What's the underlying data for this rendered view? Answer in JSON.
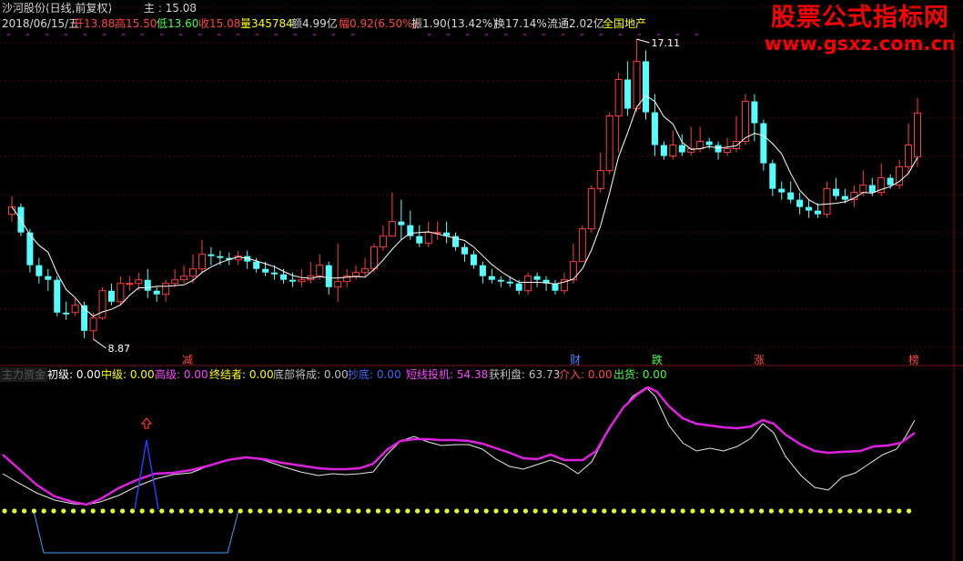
{
  "header": {
    "title": "沙河股份(日线,前复权)",
    "date": "2018/06/15/五",
    "main_label": "主 : 15.08",
    "open": "开13.88",
    "high": "高15.50",
    "low": "低13.60",
    "close": "收15.08",
    "volume": "量345784",
    "amount": "额4.99亿",
    "change": "幅0.92(6.50%)",
    "amplitude": "振1.90(13.42%)",
    "turnover": "换17.14%",
    "float_shares": "流通2.02亿",
    "sector": "全国地产"
  },
  "watermark": {
    "line1": "股票公式指标网",
    "line2": "www.gsxz.com.cn"
  },
  "chart_labels": {
    "high_mark": "17.11",
    "low_mark": "8.87"
  },
  "event_tags": [
    {
      "text": "减",
      "color": "#ff4444"
    },
    {
      "text": "财",
      "color": "#4488ff"
    },
    {
      "text": "跌",
      "color": "#44ff44"
    },
    {
      "text": "涨",
      "color": "#ff4444"
    },
    {
      "text": "榜",
      "color": "#ff4444"
    }
  ],
  "indicator": {
    "tab": "主力资金",
    "items": [
      {
        "label": "初级: 0.00",
        "color": "#ffffff"
      },
      {
        "label": "中级: 0.00",
        "color": "#ffff00"
      },
      {
        "label": "高级: 0.00",
        "color": "#ff44ff"
      },
      {
        "label": "终结者: 0.00",
        "color": "#ffff00"
      },
      {
        "label": "底部将成: 0.00",
        "color": "#c0c0c0"
      },
      {
        "label": "抄底: 0.00",
        "color": "#4466ff"
      },
      {
        "label": "短线投机: 54.38",
        "color": "#ff44ff"
      },
      {
        "label": "获利盘: 63.73",
        "color": "#c0c0c0"
      },
      {
        "label": "介入: 0.00",
        "color": "#ff4444"
      },
      {
        "label": "出货: 0.00",
        "color": "#44ff44"
      }
    ]
  },
  "colors": {
    "up": "#ff3c3c",
    "down": "#54ffff",
    "ma": "#ffffff",
    "bg": "#000000",
    "grid": "#3a0000"
  },
  "chart_data": {
    "type": "candlestick",
    "price_high": 17.11,
    "price_low": 8.87,
    "candles": [
      [
        12.3,
        12.5,
        12.8,
        12.1
      ],
      [
        12.5,
        11.8,
        12.6,
        11.7
      ],
      [
        11.8,
        10.9,
        11.9,
        10.7
      ],
      [
        10.9,
        10.6,
        11.1,
        10.4
      ],
      [
        10.6,
        10.5,
        10.8,
        10.2
      ],
      [
        10.5,
        9.6,
        10.6,
        9.5
      ],
      [
        9.6,
        9.55,
        9.9,
        9.4
      ],
      [
        9.6,
        9.8,
        10.0,
        9.5
      ],
      [
        9.8,
        9.1,
        9.9,
        8.9
      ],
      [
        9.1,
        9.45,
        9.6,
        8.87
      ],
      [
        9.45,
        10.2,
        10.3,
        9.4
      ],
      [
        10.2,
        9.9,
        10.4,
        9.8
      ],
      [
        9.9,
        10.4,
        10.6,
        9.8
      ],
      [
        10.4,
        10.4,
        10.6,
        10.2
      ],
      [
        10.4,
        10.5,
        10.7,
        10.2
      ],
      [
        10.5,
        10.2,
        10.8,
        10.0
      ],
      [
        10.2,
        10.1,
        10.3,
        9.9
      ],
      [
        10.1,
        10.4,
        10.5,
        9.9
      ],
      [
        10.4,
        10.5,
        10.8,
        10.3
      ],
      [
        10.5,
        10.6,
        10.9,
        10.4
      ],
      [
        10.6,
        10.8,
        11.2,
        10.4
      ],
      [
        10.8,
        11.2,
        11.6,
        10.7
      ],
      [
        11.2,
        11.15,
        11.4,
        10.9
      ],
      [
        11.15,
        11.1,
        11.3,
        10.9
      ],
      [
        11.1,
        11.05,
        11.25,
        10.9
      ],
      [
        11.05,
        11.15,
        11.3,
        10.9
      ],
      [
        11.15,
        11.0,
        11.3,
        10.8
      ],
      [
        11.0,
        10.8,
        11.1,
        10.7
      ],
      [
        10.8,
        10.7,
        11.0,
        10.6
      ],
      [
        10.7,
        10.65,
        10.9,
        10.5
      ],
      [
        10.65,
        10.5,
        10.8,
        10.4
      ],
      [
        10.5,
        10.45,
        10.7,
        10.3
      ],
      [
        10.45,
        10.5,
        10.8,
        10.3
      ],
      [
        10.5,
        10.6,
        11.0,
        10.4
      ],
      [
        10.6,
        10.9,
        11.2,
        10.5
      ],
      [
        10.9,
        10.3,
        11.0,
        10.1
      ],
      [
        10.3,
        10.45,
        11.5,
        9.9
      ],
      [
        10.45,
        10.6,
        10.8,
        10.3
      ],
      [
        10.6,
        10.7,
        10.9,
        10.5
      ],
      [
        10.7,
        10.8,
        11.1,
        10.6
      ],
      [
        10.8,
        11.4,
        11.5,
        10.7
      ],
      [
        11.4,
        11.7,
        12.0,
        11.3
      ],
      [
        11.7,
        12.1,
        12.9,
        11.7
      ],
      [
        12.1,
        12.0,
        12.7,
        11.6
      ],
      [
        12.0,
        11.7,
        12.4,
        11.6
      ],
      [
        11.7,
        11.5,
        12.0,
        11.4
      ],
      [
        11.5,
        11.8,
        12.1,
        11.4
      ],
      [
        11.8,
        11.8,
        12.1,
        11.6
      ],
      [
        11.8,
        11.7,
        12.1,
        11.5
      ],
      [
        11.7,
        11.4,
        11.8,
        11.3
      ],
      [
        11.4,
        11.2,
        11.5,
        11.0
      ],
      [
        11.2,
        10.9,
        11.3,
        10.8
      ],
      [
        10.9,
        10.6,
        11.0,
        10.4
      ],
      [
        10.6,
        10.5,
        10.8,
        10.4
      ],
      [
        10.5,
        10.45,
        10.6,
        10.3
      ],
      [
        10.45,
        10.4,
        10.6,
        10.3
      ],
      [
        10.4,
        10.2,
        10.5,
        10.1
      ],
      [
        10.2,
        10.6,
        10.7,
        10.1
      ],
      [
        10.6,
        10.5,
        10.7,
        10.3
      ],
      [
        10.5,
        10.4,
        10.6,
        10.2
      ],
      [
        10.4,
        10.2,
        10.5,
        10.1
      ],
      [
        10.2,
        10.5,
        10.7,
        10.1
      ],
      [
        10.5,
        11.0,
        11.5,
        10.4
      ],
      [
        11.0,
        11.9,
        12.0,
        11.0
      ],
      [
        11.9,
        13.0,
        13.1,
        11.8
      ],
      [
        13.0,
        13.5,
        14.0,
        12.9
      ],
      [
        13.5,
        15.0,
        15.1,
        13.4
      ],
      [
        15.0,
        16.0,
        16.2,
        14.0
      ],
      [
        16.0,
        15.2,
        16.5,
        15.0
      ],
      [
        15.2,
        16.5,
        17.11,
        15.1
      ],
      [
        16.5,
        15.1,
        16.8,
        14.9
      ],
      [
        15.1,
        14.2,
        15.6,
        13.9
      ],
      [
        14.2,
        13.9,
        14.3,
        13.8
      ],
      [
        13.9,
        14.2,
        14.6,
        13.8
      ],
      [
        14.2,
        14.0,
        14.5,
        13.9
      ],
      [
        14.0,
        14.1,
        14.7,
        13.9
      ],
      [
        14.1,
        14.3,
        14.7,
        14.0
      ],
      [
        14.3,
        14.2,
        14.4,
        14.1
      ],
      [
        14.2,
        14.0,
        14.3,
        13.8
      ],
      [
        14.0,
        14.1,
        14.4,
        13.9
      ],
      [
        14.1,
        14.3,
        15.0,
        14.0
      ],
      [
        14.3,
        15.4,
        15.6,
        14.2
      ],
      [
        15.4,
        14.8,
        15.6,
        14.3
      ],
      [
        14.8,
        13.7,
        14.9,
        13.5
      ],
      [
        13.7,
        13.0,
        13.8,
        12.8
      ],
      [
        13.0,
        12.9,
        13.2,
        12.7
      ],
      [
        12.9,
        12.7,
        13.2,
        12.6
      ],
      [
        12.7,
        12.5,
        12.9,
        12.3
      ],
      [
        12.5,
        12.4,
        12.7,
        12.2
      ],
      [
        12.4,
        12.3,
        12.6,
        12.2
      ],
      [
        12.3,
        13.0,
        13.2,
        12.2
      ],
      [
        13.0,
        12.8,
        13.3,
        12.7
      ],
      [
        12.8,
        12.7,
        13.0,
        12.6
      ],
      [
        12.7,
        12.9,
        13.1,
        12.5
      ],
      [
        12.9,
        13.1,
        13.5,
        12.8
      ],
      [
        13.1,
        12.9,
        13.3,
        12.8
      ],
      [
        12.9,
        13.3,
        13.7,
        12.8
      ],
      [
        13.3,
        13.1,
        13.4,
        13.0
      ],
      [
        13.1,
        13.6,
        13.8,
        13.0
      ],
      [
        13.6,
        14.2,
        14.8,
        13.4
      ],
      [
        13.88,
        15.08,
        15.5,
        13.6
      ]
    ]
  }
}
